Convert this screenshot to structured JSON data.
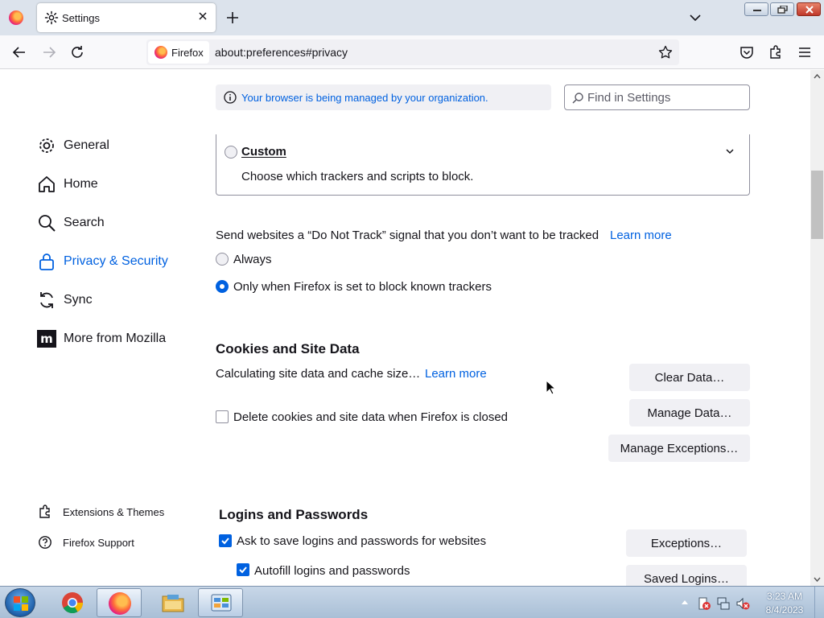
{
  "window": {
    "tab_title": "Settings"
  },
  "navbar": {
    "identity_label": "Firefox",
    "url": "about:preferences#privacy"
  },
  "banner": {
    "managed_text": "Your browser is being managed by your organization."
  },
  "search": {
    "placeholder": "Find in Settings"
  },
  "sidebar": {
    "items": [
      {
        "label": "General",
        "icon": "gear-icon"
      },
      {
        "label": "Home",
        "icon": "home-icon"
      },
      {
        "label": "Search",
        "icon": "search-icon"
      },
      {
        "label": "Privacy & Security",
        "icon": "lock-icon",
        "selected": true
      },
      {
        "label": "Sync",
        "icon": "sync-icon"
      },
      {
        "label": "More from Mozilla",
        "icon": "mozilla-icon"
      }
    ],
    "footer": [
      {
        "label": "Extensions & Themes",
        "icon": "puzzle-icon"
      },
      {
        "label": "Firefox Support",
        "icon": "help-icon"
      }
    ]
  },
  "tracking": {
    "custom_label": "Custom",
    "custom_desc": "Choose which trackers and scripts to block.",
    "dnt_text": "Send websites a “Do Not Track” signal that you don’t want to be tracked",
    "learn_more": "Learn more",
    "always": "Always",
    "only_when": "Only when Firefox is set to block known trackers"
  },
  "cookies": {
    "heading": "Cookies and Site Data",
    "calc_text": "Calculating site data and cache size…",
    "learn_more": "Learn more",
    "clear_button": "Clear Data…",
    "manage_button": "Manage Data…",
    "exceptions_button": "Manage Exceptions…",
    "delete_label": "Delete cookies and site data when Firefox is closed",
    "delete_checked": false
  },
  "logins": {
    "heading": "Logins and Passwords",
    "ask_label": "Ask to save logins and passwords for websites",
    "ask_checked": true,
    "autofill_label": "Autofill logins and passwords",
    "autofill_checked": true,
    "exceptions_button": "Exceptions…",
    "saved_button": "Saved Logins…"
  },
  "taskbar": {
    "time": "3:23 AM",
    "date": "8/4/2023",
    "apps": [
      "chrome-icon",
      "firefox-icon",
      "file-explorer-icon",
      "control-panel-icon"
    ]
  },
  "colors": {
    "accent": "#0061e0",
    "tabstrip": "#dce3ec",
    "taskbar": "#a9bfd6"
  }
}
